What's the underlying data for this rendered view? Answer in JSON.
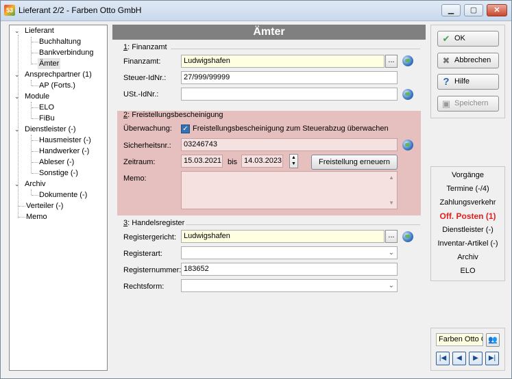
{
  "window": {
    "title": "Lieferant 2/2 - Farben Otto GmbH",
    "app_icon_text": "53"
  },
  "tree": {
    "lieferant": "Lieferant",
    "buchhaltung": "Buchhaltung",
    "bankverbindung": "Bankverbindung",
    "aemter": "Ämter",
    "ansprechpartner": "Ansprechpartner (1)",
    "ap": "AP (Forts.)",
    "module": "Module",
    "elo": "ELO",
    "fibu": "FiBu",
    "dienstleister": "Dienstleister (-)",
    "hausmeister": "Hausmeister (-)",
    "handwerker": "Handwerker (-)",
    "ableser": "Ableser (-)",
    "sonstige": "Sonstige (-)",
    "archiv": "Archiv",
    "dokumente": "Dokumente (-)",
    "verteiler": "Verteiler (-)",
    "memo": "Memo"
  },
  "panel": {
    "title": "Ämter",
    "finanzamt": {
      "group_num": "1",
      "group_title": ": Finanzamt",
      "finanzamt_label": "Finanzamt:",
      "finanzamt_value": "Ludwigshafen",
      "steuer_label": "Steuer-IdNr.:",
      "steuer_value": "27/999/99999",
      "ust_label": "USt.-IdNr.:",
      "ust_value": ""
    },
    "freistellung": {
      "group_num": "2",
      "group_title": ": Freistellungsbescheinigung",
      "ueberwachung_label": "Überwachung:",
      "checkbox_label": "Freistellungsbescheinigung zum Steuerabzug überwachen",
      "sicherheit_label": "Sicherheitsnr.:",
      "sicherheit_value": "03246743",
      "zeitraum_label": "Zeitraum:",
      "von": "15.03.2021",
      "bis_label": "bis",
      "bis": "14.03.2023",
      "erneuern": "Freistellung erneuern",
      "memo_label": "Memo:"
    },
    "handelsregister": {
      "group_num": "3",
      "group_title": ": Handelsregister",
      "gericht_label": "Registergericht:",
      "gericht_value": "Ludwigshafen",
      "art_label": "Registerart:",
      "art_value": "",
      "nummer_label": "Registernummer:",
      "nummer_value": "183652",
      "rechtsform_label": "Rechtsform:",
      "rechtsform_value": ""
    }
  },
  "actions": {
    "ok": "OK",
    "abbrechen": "Abbrechen",
    "hilfe": "Hilfe",
    "speichern": "Speichern"
  },
  "side_nav": {
    "vorgaenge": "Vorgänge",
    "termine": "Termine (-/4)",
    "zahlungsverkehr": "Zahlungsverkehr",
    "off_posten": "Off. Posten (1)",
    "dienstleister": "Dienstleister (-)",
    "inventar": "Inventar-Artikel (-)",
    "archiv": "Archiv",
    "elo": "ELO"
  },
  "record_nav": {
    "current": "Farben Otto GmbH"
  },
  "colors": {
    "highlight": "#e6bfbf",
    "alert": "#e02020",
    "lookup_field": "#ffffe1"
  }
}
